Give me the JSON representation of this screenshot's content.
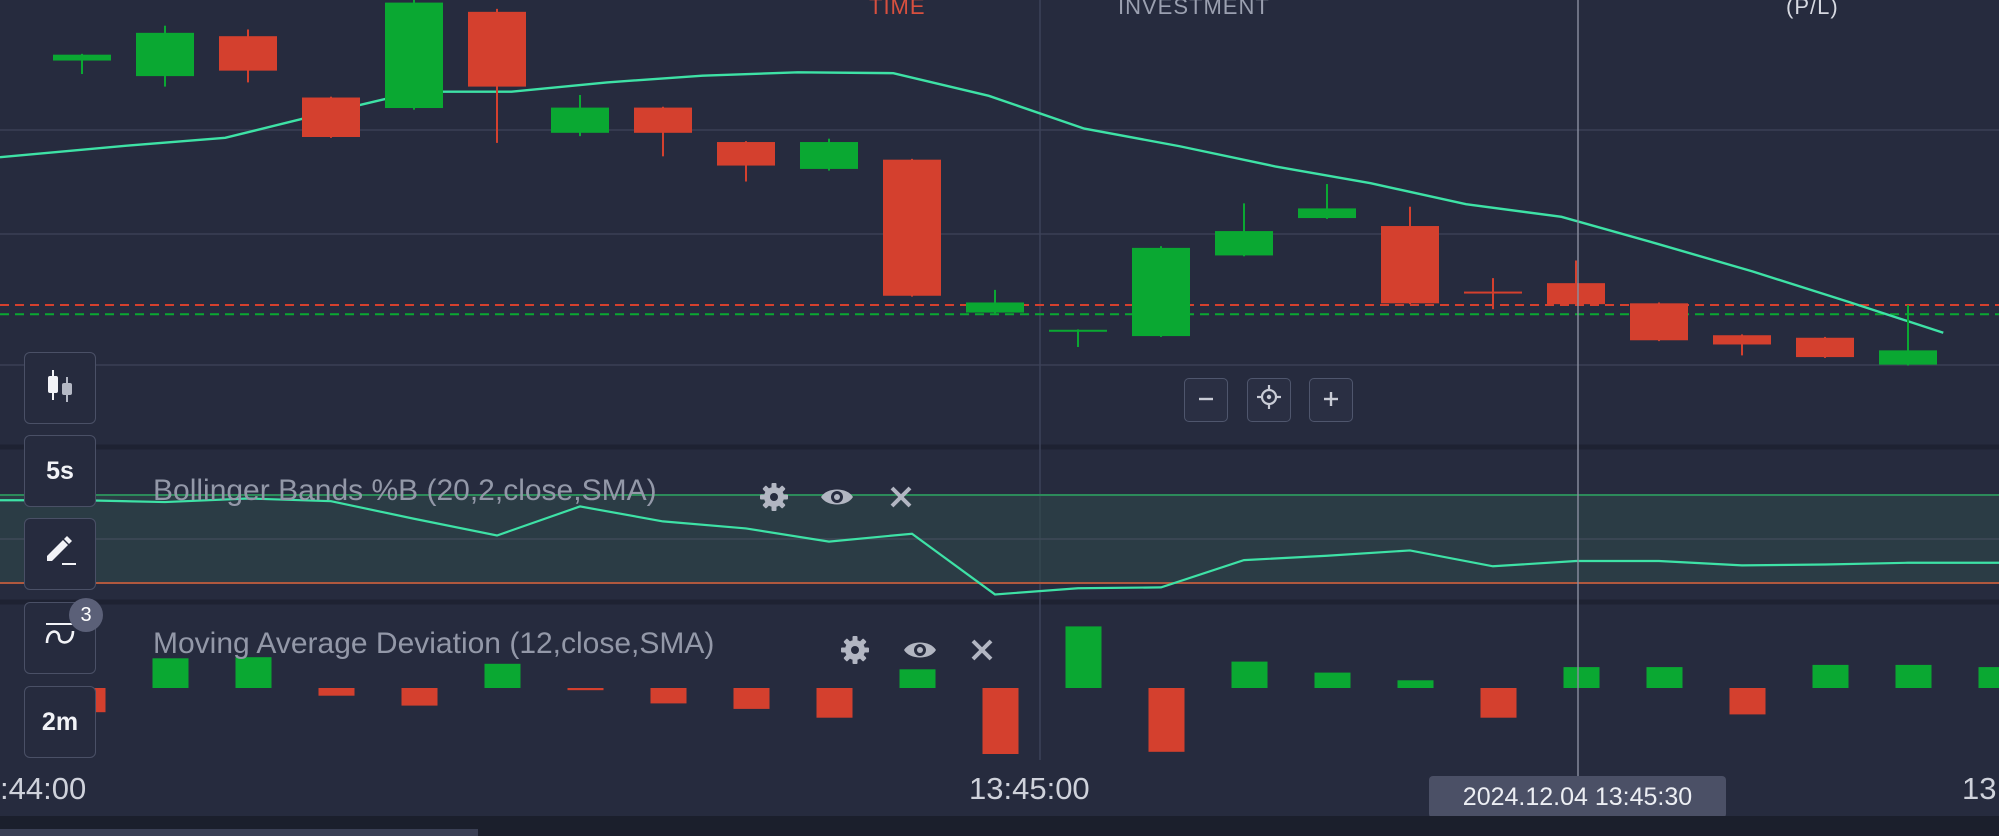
{
  "header": {
    "time_label": "TIME",
    "investment_label": "INVESTMENT",
    "pl_label": "(P/L)"
  },
  "toolbar": {
    "chart_type_icon": "candlestick-icon",
    "timeframe_label": "5s",
    "draw_icon": "pencil-icon",
    "indicators_icon": "indicator-wave-icon",
    "indicators_count": "3",
    "interval_label": "2m"
  },
  "zoom": {
    "zoom_out_icon": "minus-icon",
    "center_icon": "crosshair-icon",
    "zoom_in_icon": "plus-icon"
  },
  "indicators": [
    {
      "label": "Bollinger Bands %B (20,2,close,SMA)",
      "settings_icon": "gear-icon",
      "visibility_icon": "eye-icon",
      "remove_icon": "close-icon"
    },
    {
      "label": "Moving Average Deviation (12,close,SMA)",
      "settings_icon": "gear-icon",
      "visibility_icon": "eye-icon",
      "remove_icon": "close-icon"
    }
  ],
  "time_axis": {
    "labels": [
      ":44:00",
      "13:45:00",
      "13"
    ]
  },
  "crosshair_tooltip": "2024.12.04 13:45:30",
  "colors": {
    "background": "#262b3e",
    "bull": "#0aa832",
    "bear": "#d4402e",
    "line": "#3ee2a6",
    "axis_text": "#cfd2db"
  },
  "chart_data": {
    "type": "candlestick",
    "price_panel": {
      "candles": [
        {
          "o": 58.2,
          "c": 59.6,
          "h": 59.8,
          "l": 55.0
        },
        {
          "o": 54.5,
          "c": 64.8,
          "h": 66.5,
          "l": 52.0
        },
        {
          "o": 64.0,
          "c": 55.8,
          "h": 65.6,
          "l": 53.0
        },
        {
          "o": 49.4,
          "c": 40.0,
          "h": 49.6,
          "l": 39.8
        },
        {
          "o": 46.9,
          "c": 72.0,
          "h": 73.0,
          "l": 46.5
        },
        {
          "o": 69.8,
          "c": 52.0,
          "h": 70.5,
          "l": 38.6
        },
        {
          "o": 41.0,
          "c": 47.0,
          "h": 50.0,
          "l": 40.2
        },
        {
          "o": 47.0,
          "c": 41.0,
          "h": 47.2,
          "l": 35.4
        },
        {
          "o": 38.8,
          "c": 33.2,
          "h": 39.0,
          "l": 29.4
        },
        {
          "o": 32.4,
          "c": 38.8,
          "h": 39.6,
          "l": 32.0
        },
        {
          "o": 34.6,
          "c": 2.2,
          "h": 34.8,
          "l": 2.0
        },
        {
          "o": -1.8,
          "c": 0.6,
          "h": 3.6,
          "l": -2.0
        },
        {
          "o": -6.1,
          "c": -5.9,
          "h": -5.8,
          "l": -10.0
        },
        {
          "o": -7.4,
          "c": 13.6,
          "h": 14.0,
          "l": -7.6
        },
        {
          "o": 11.8,
          "c": 17.6,
          "h": 24.2,
          "l": 11.6
        },
        {
          "o": 20.7,
          "c": 23.0,
          "h": 28.8,
          "l": 20.5
        },
        {
          "o": 18.8,
          "c": 0.4,
          "h": 23.4,
          "l": 0.2
        },
        {
          "o": 3.2,
          "c": 3.0,
          "h": 6.4,
          "l": -1.0
        },
        {
          "o": 5.2,
          "c": 0.2,
          "h": 10.6,
          "l": 0.0
        },
        {
          "o": 0.4,
          "c": -8.4,
          "h": 0.6,
          "l": -8.6
        },
        {
          "o": -7.2,
          "c": -9.4,
          "h": -7.0,
          "l": -12.0
        },
        {
          "o": -7.8,
          "c": -12.4,
          "h": -7.6,
          "l": -12.6
        },
        {
          "o": -14.2,
          "c": -10.8,
          "h": 0.0,
          "l": -14.4
        }
      ],
      "moving_average": [
        38.0,
        39.8,
        45.4,
        50.8,
        50.8,
        53.0,
        54.6,
        55.4,
        55.2,
        49.8,
        42.0,
        37.8,
        33.0,
        29.0,
        24.0,
        21.0,
        14.6,
        8.0,
        0.8,
        -6.6
      ],
      "ref_lines": {
        "red_dashed": 0.0,
        "green_dashed": -2.2
      }
    },
    "percent_b_panel": {
      "values": [
        0.94,
        0.92,
        0.96,
        0.93,
        0.73,
        0.54,
        0.87,
        0.7,
        0.62,
        0.47,
        0.56,
        -0.13,
        -0.06,
        -0.05,
        0.26,
        0.31,
        0.37,
        0.19,
        0.25,
        0.25,
        0.2,
        0.21,
        0.23
      ],
      "upper_band": 1.0,
      "lower_band": 0.0
    },
    "deviation_panel": {
      "values": [
        -2.2,
        2.7,
        2.8,
        -0.7,
        -1.6,
        2.2,
        -0.2,
        -1.4,
        -1.9,
        -2.7,
        1.7,
        -6.0,
        5.6,
        -5.8,
        2.4,
        1.4,
        0.7,
        -2.7,
        1.9,
        1.9,
        -2.4,
        2.1,
        2.1,
        1.9
      ]
    }
  }
}
